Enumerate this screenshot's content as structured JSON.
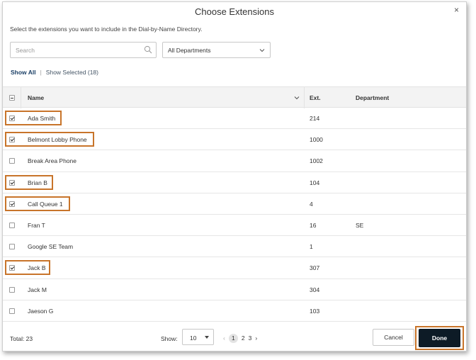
{
  "dialog": {
    "title": "Choose Extensions",
    "close_label": "×",
    "instruction": "Select the extensions you want to include in the Dial-by-Name Directory."
  },
  "search": {
    "placeholder": "Search",
    "value": ""
  },
  "department_filter": {
    "selected": "All Departments"
  },
  "filters": {
    "show_all": "Show All",
    "separator": "|",
    "show_selected": "Show Selected (18)"
  },
  "table": {
    "columns": {
      "name": "Name",
      "ext": "Ext.",
      "department": "Department"
    },
    "rows": [
      {
        "name": "Ada Smith",
        "ext": "214",
        "department": "",
        "checked": true
      },
      {
        "name": "Belmont Lobby Phone",
        "ext": "1000",
        "department": "",
        "checked": true
      },
      {
        "name": "Break Area Phone",
        "ext": "1002",
        "department": "",
        "checked": false
      },
      {
        "name": "Brian B",
        "ext": "104",
        "department": "",
        "checked": true
      },
      {
        "name": "Call Queue 1",
        "ext": "4",
        "department": "",
        "checked": true
      },
      {
        "name": "Fran T",
        "ext": "16",
        "department": "SE",
        "checked": false
      },
      {
        "name": "Google SE Team",
        "ext": "1",
        "department": "",
        "checked": false
      },
      {
        "name": "Jack B",
        "ext": "307",
        "department": "",
        "checked": true
      },
      {
        "name": "Jack M",
        "ext": "304",
        "department": "",
        "checked": false
      },
      {
        "name": "Jaeson G",
        "ext": "103",
        "department": "",
        "checked": false
      }
    ]
  },
  "footer": {
    "total": "Total: 23",
    "show_label": "Show:",
    "page_size": "10",
    "pager": {
      "prev": "‹",
      "pages": [
        "1",
        "2",
        "3"
      ],
      "next": "›"
    },
    "cancel": "Cancel",
    "done": "Done"
  },
  "colors": {
    "highlight": "#c8742a",
    "done_bg": "#0d1b26"
  }
}
